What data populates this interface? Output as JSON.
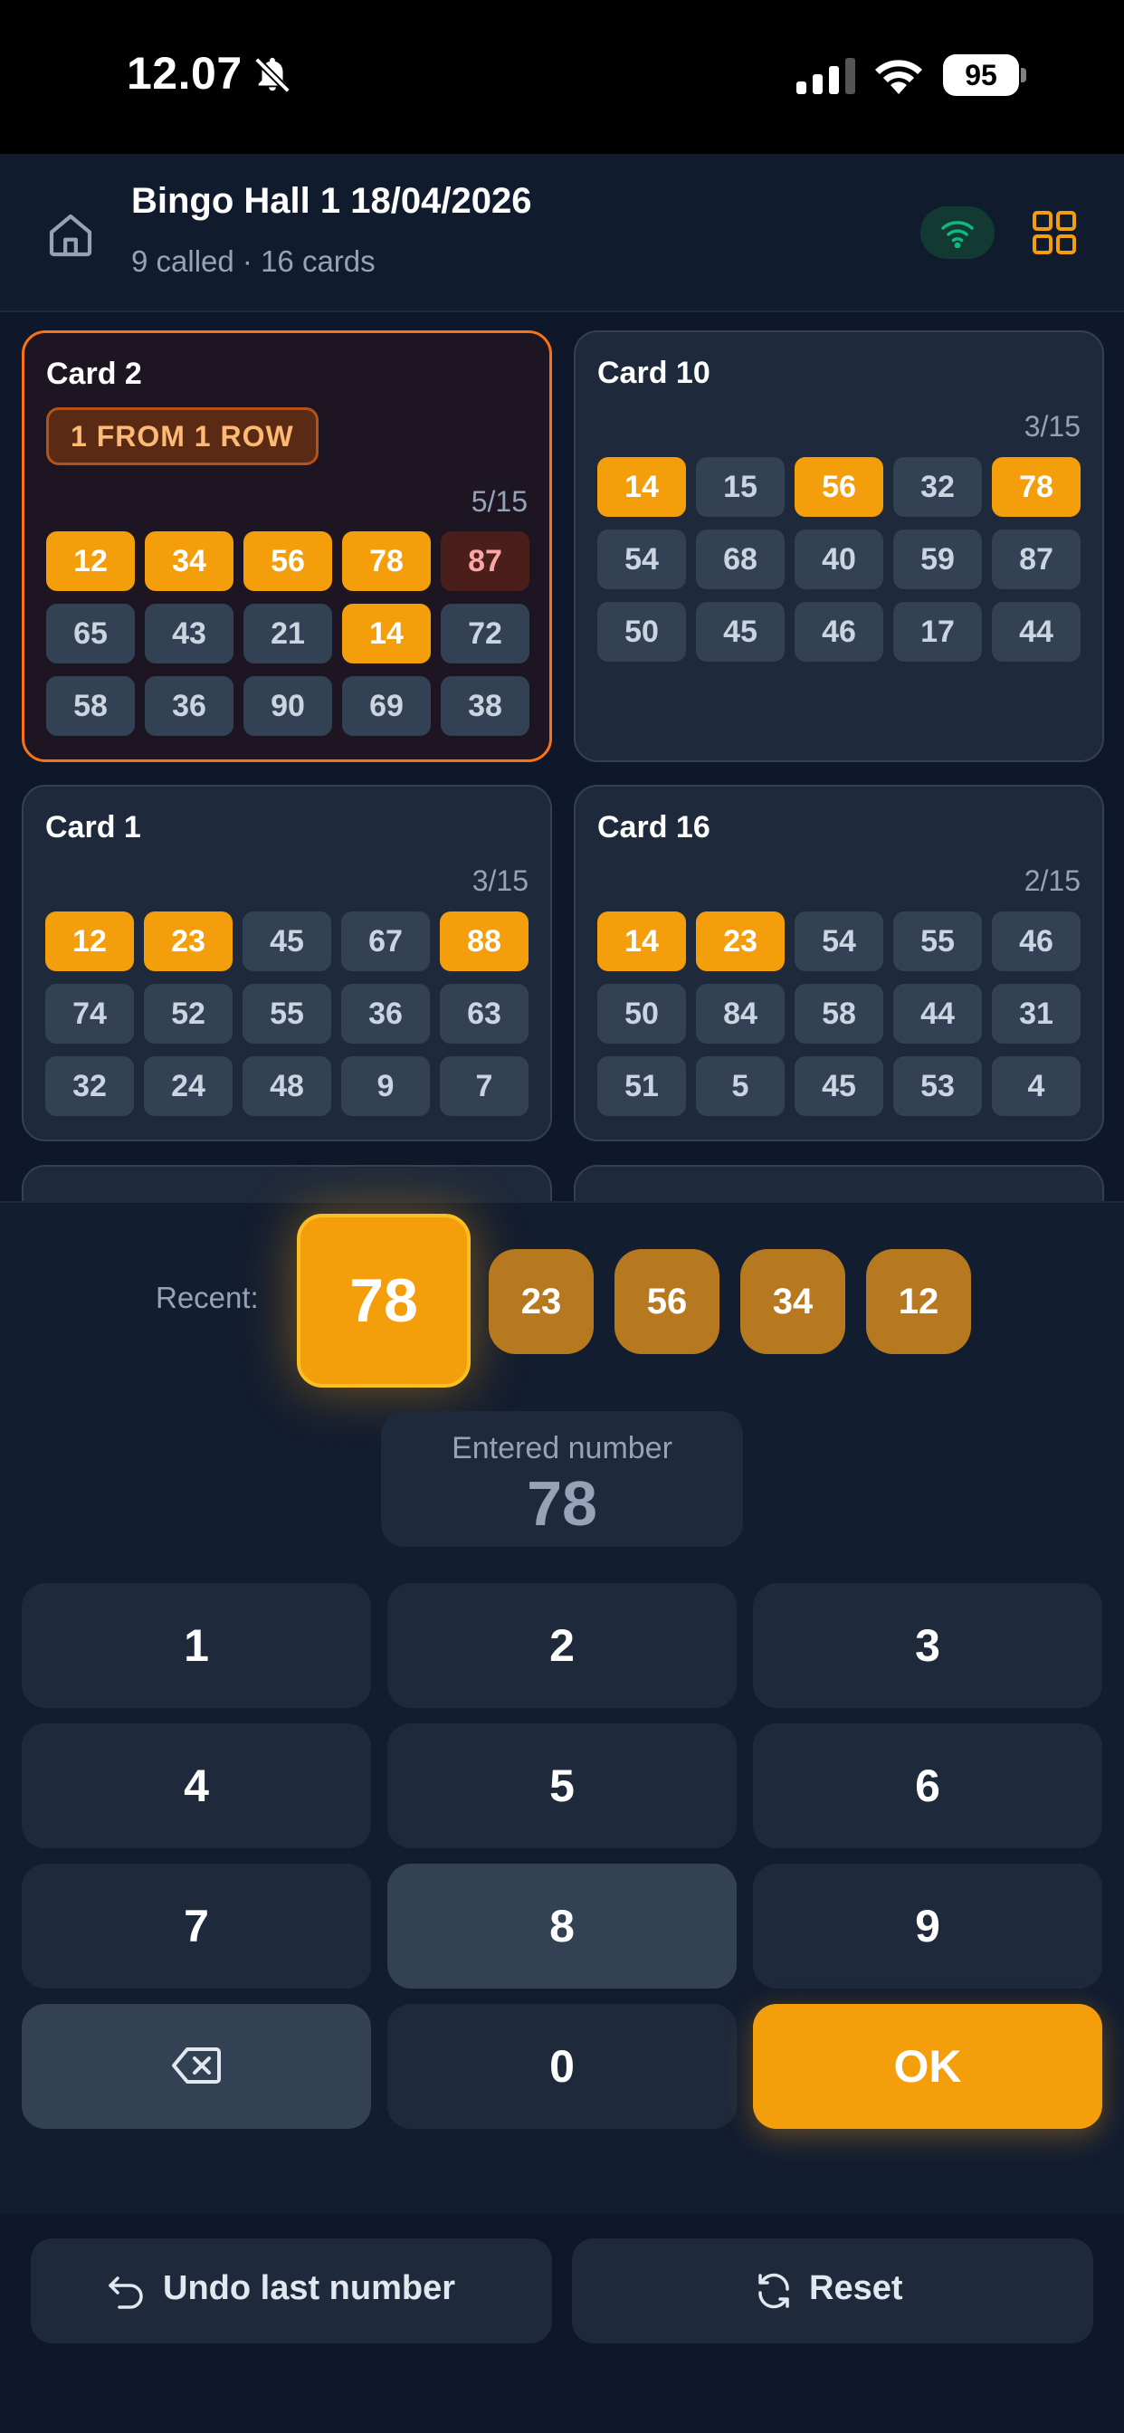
{
  "status": {
    "time": "12.07",
    "battery": "95"
  },
  "header": {
    "title": "Bingo Hall 1 18/04/2026",
    "subtitle": "9 called · 16 cards"
  },
  "cards": [
    {
      "title": "Card 2",
      "badge": "1 FROM 1 ROW",
      "count": "5/15",
      "rows": [
        [
          "12",
          "34",
          "56",
          "78",
          "87"
        ],
        [
          "65",
          "43",
          "21",
          "14",
          "72"
        ],
        [
          "58",
          "36",
          "90",
          "69",
          "38"
        ]
      ]
    },
    {
      "title": "Card 10",
      "count": "3/15",
      "rows": [
        [
          "14",
          "15",
          "56",
          "32",
          "78"
        ],
        [
          "54",
          "68",
          "40",
          "59",
          "87"
        ],
        [
          "50",
          "45",
          "46",
          "17",
          "44"
        ]
      ]
    },
    {
      "title": "Card 1",
      "count": "3/15",
      "rows": [
        [
          "12",
          "23",
          "45",
          "67",
          "88"
        ],
        [
          "74",
          "52",
          "55",
          "36",
          "63"
        ],
        [
          "32",
          "24",
          "48",
          "9",
          "7"
        ]
      ]
    },
    {
      "title": "Card 16",
      "count": "2/15",
      "rows": [
        [
          "14",
          "23",
          "54",
          "55",
          "46"
        ],
        [
          "50",
          "84",
          "58",
          "44",
          "31"
        ],
        [
          "51",
          "5",
          "45",
          "53",
          "4"
        ]
      ]
    }
  ],
  "panel": {
    "recent_label": "Recent:",
    "recent": [
      "78",
      "23",
      "56",
      "34",
      "12"
    ],
    "entered_label": "Entered number",
    "entered_value": "78"
  },
  "keypad": {
    "keys": [
      "1",
      "2",
      "3",
      "4",
      "5",
      "6",
      "7",
      "8",
      "9",
      "0"
    ],
    "backspace_icon": "backspace-icon",
    "ok_label": "OK"
  },
  "footer": {
    "undo_label": "Undo last number",
    "reset_label": "Reset"
  },
  "colors": {
    "accent": "#f59e0b",
    "background": "#0f172a",
    "active_card_border": "#f97316"
  }
}
